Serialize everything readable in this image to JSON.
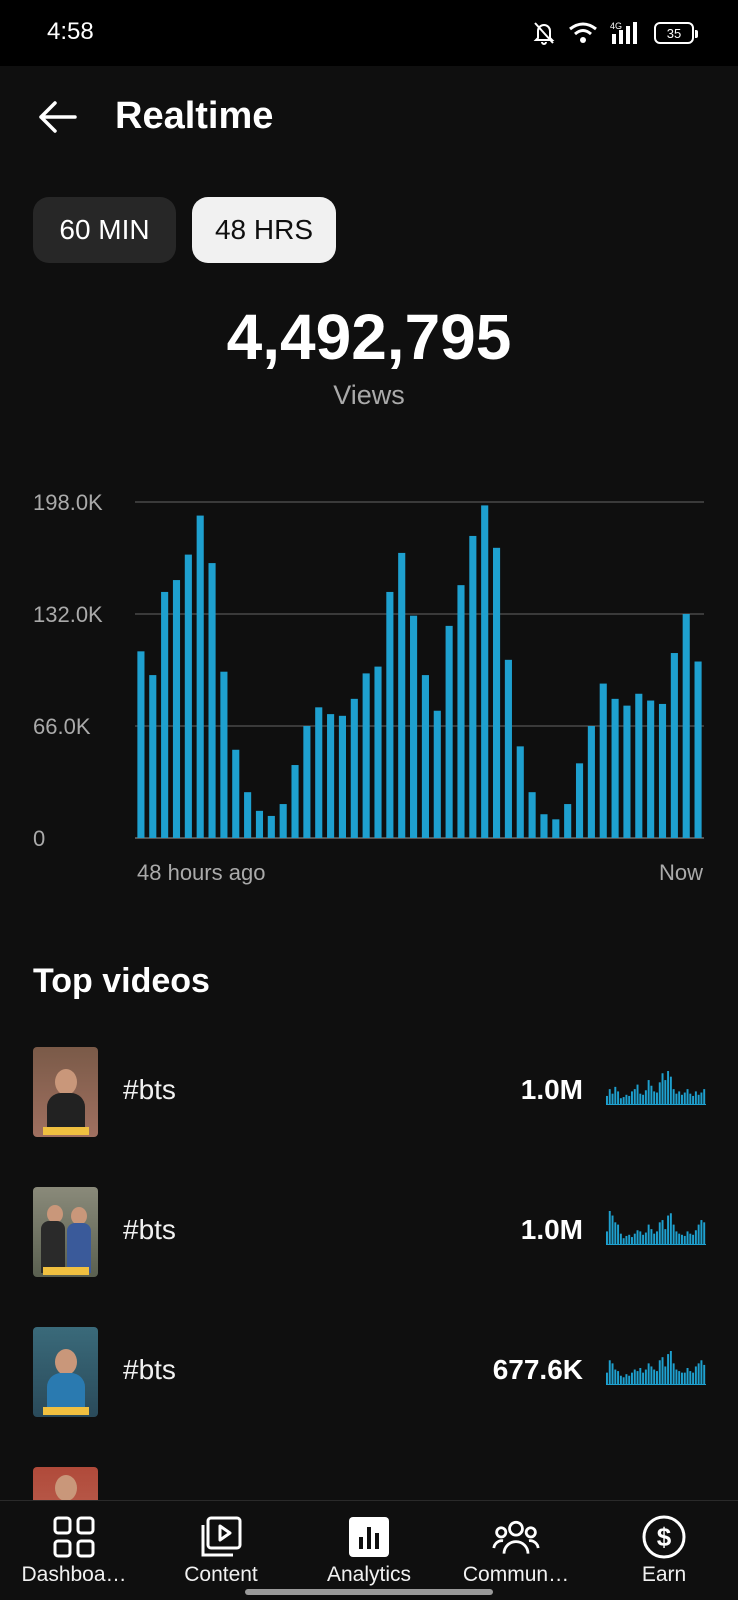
{
  "status_bar": {
    "time": "4:58",
    "battery": "35",
    "network": "4G"
  },
  "header": {
    "title": "Realtime"
  },
  "range_tabs": [
    {
      "label": "60 MIN",
      "selected": false
    },
    {
      "label": "48 HRS",
      "selected": true
    }
  ],
  "metric": {
    "value": "4,492,795",
    "label": "Views"
  },
  "chart_data": {
    "type": "bar",
    "ylim": [
      0,
      198000
    ],
    "y_tick_labels": [
      "198.0K",
      "132.0K",
      "66.0K",
      "0"
    ],
    "x_label_start": "48 hours ago",
    "x_label_end": "Now",
    "grid": true,
    "color": "#1ea0cf",
    "values": [
      110000,
      96000,
      145000,
      152000,
      167000,
      190000,
      162000,
      98000,
      52000,
      27000,
      16000,
      13000,
      20000,
      43000,
      66000,
      77000,
      73000,
      72000,
      82000,
      97000,
      101000,
      145000,
      168000,
      131000,
      96000,
      75000,
      125000,
      149000,
      178000,
      196000,
      171000,
      105000,
      54000,
      27000,
      14000,
      11000,
      20000,
      44000,
      66000,
      91000,
      82000,
      78000,
      85000,
      81000,
      79000,
      109000,
      132000,
      104000
    ]
  },
  "top_videos": {
    "title": "Top videos",
    "items": [
      {
        "title": "#bts",
        "views": "1.0M",
        "spark": [
          8,
          14,
          10,
          16,
          12,
          6,
          7,
          9,
          8,
          12,
          14,
          18,
          10,
          9,
          13,
          22,
          17,
          12,
          11,
          20,
          28,
          22,
          30,
          25,
          14,
          10,
          12,
          9,
          11,
          14,
          10,
          8,
          12,
          9,
          11,
          14
        ]
      },
      {
        "title": "#bts",
        "views": "1.0M",
        "spark": [
          12,
          30,
          26,
          20,
          18,
          10,
          6,
          8,
          9,
          7,
          10,
          13,
          12,
          9,
          11,
          18,
          14,
          10,
          12,
          20,
          22,
          14,
          26,
          28,
          18,
          12,
          10,
          9,
          8,
          12,
          10,
          9,
          13,
          18,
          22,
          20
        ]
      },
      {
        "title": "#bts",
        "views": "677.6K",
        "spark": [
          8,
          16,
          14,
          10,
          9,
          6,
          5,
          7,
          6,
          8,
          10,
          9,
          11,
          8,
          10,
          14,
          12,
          10,
          9,
          16,
          18,
          12,
          20,
          22,
          14,
          10,
          9,
          8,
          8,
          11,
          9,
          8,
          12,
          14,
          16,
          13
        ]
      }
    ]
  },
  "bottom_nav": [
    {
      "label": "Dashboa…",
      "icon": "dashboard-icon",
      "active": false
    },
    {
      "label": "Content",
      "icon": "content-icon",
      "active": false
    },
    {
      "label": "Analytics",
      "icon": "analytics-icon",
      "active": true
    },
    {
      "label": "Commun…",
      "icon": "community-icon",
      "active": false
    },
    {
      "label": "Earn",
      "icon": "earn-icon",
      "active": false
    }
  ]
}
